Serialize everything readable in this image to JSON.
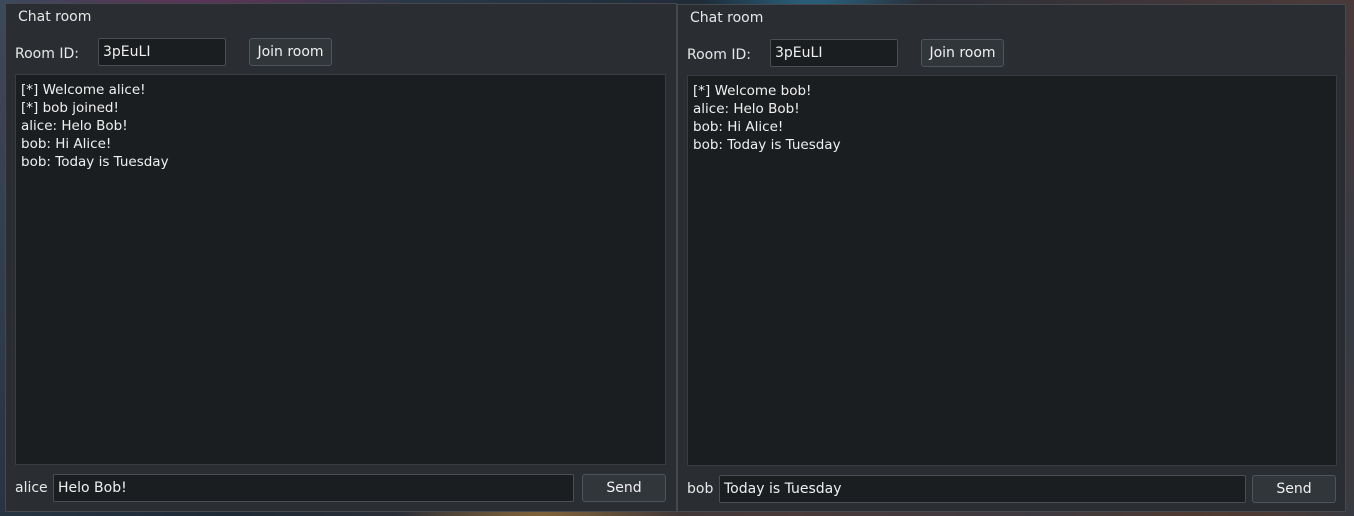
{
  "windows": [
    {
      "title": "Chat room",
      "room_label": "Room ID:",
      "room_id": "3pEuLI",
      "join_label": "Join room",
      "messages": [
        "[*] Welcome alice!",
        "[*] bob joined!",
        "alice: Helo Bob!",
        "bob: Hi Alice!",
        "bob: Today is Tuesday"
      ],
      "user_label": "alice",
      "message_input": "Helo Bob!",
      "send_label": "Send"
    },
    {
      "title": "Chat room",
      "room_label": "Room ID:",
      "room_id": "3pEuLI",
      "join_label": "Join room",
      "messages": [
        "[*] Welcome bob!",
        "alice: Helo Bob!",
        "bob: Hi Alice!",
        "bob: Today is Tuesday"
      ],
      "user_label": "bob",
      "message_input": "Today is Tuesday",
      "send_label": "Send"
    }
  ]
}
